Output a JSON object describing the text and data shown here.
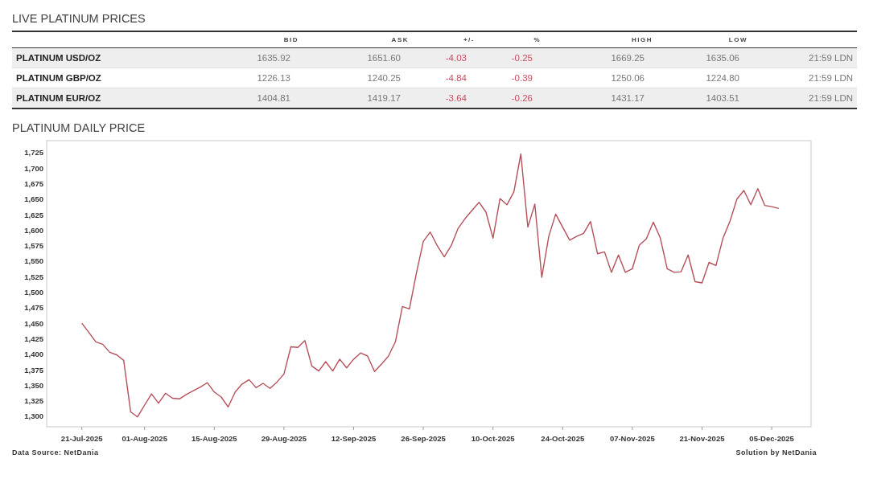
{
  "live_prices": {
    "title": "LIVE PLATINUM PRICES",
    "columns": [
      "",
      "BID",
      "ASK",
      "+/-",
      "%",
      "HIGH",
      "LOW",
      ""
    ],
    "rows": [
      {
        "cells": [
          "PLATINUM USD/OZ",
          "1635.92",
          "1651.60",
          "-4.03",
          "-0.25",
          "1669.25",
          "1635.06",
          "21:59 LDN"
        ]
      },
      {
        "cells": [
          "PLATINUM GBP/OZ",
          "1226.13",
          "1240.25",
          "-4.84",
          "-0.39",
          "1250.06",
          "1224.80",
          "21:59 LDN"
        ]
      },
      {
        "cells": [
          "PLATINUM EUR/OZ",
          "1404.81",
          "1419.17",
          "-3.64",
          "-0.26",
          "1431.17",
          "1403.51",
          "21:59 LDN"
        ]
      }
    ]
  },
  "daily_chart": {
    "title": "PLATINUM DAILY PRICE",
    "chart_data": {
      "type": "line",
      "categories": [
        "21-Jul-2025",
        null,
        null,
        null,
        null,
        null,
        null,
        null,
        null,
        "01-Aug-2025",
        null,
        null,
        null,
        null,
        null,
        null,
        null,
        null,
        null,
        "15-Aug-2025",
        null,
        null,
        null,
        null,
        null,
        null,
        null,
        null,
        null,
        "29-Aug-2025",
        null,
        null,
        null,
        null,
        null,
        null,
        null,
        null,
        null,
        "12-Sep-2025",
        null,
        null,
        null,
        null,
        null,
        null,
        null,
        null,
        null,
        "26-Sep-2025",
        null,
        null,
        null,
        null,
        null,
        null,
        null,
        null,
        null,
        "10-Oct-2025",
        null,
        null,
        null,
        null,
        null,
        null,
        null,
        null,
        null,
        "24-Oct-2025",
        null,
        null,
        null,
        null,
        null,
        null,
        null,
        null,
        null,
        "07-Nov-2025",
        null,
        null,
        null,
        null,
        null,
        null,
        null,
        null,
        null,
        "21-Nov-2025",
        null,
        null,
        null,
        null,
        null,
        null,
        null,
        null,
        null,
        "05-Dec-2025",
        null
      ],
      "series": [
        {
          "color": "#b5505a",
          "values": [
            1450,
            1435,
            1420,
            1416,
            1403,
            1399,
            1390,
            1307,
            1299,
            1318,
            1336,
            1321,
            1337,
            1329,
            1328,
            1335,
            1341,
            1347,
            1354,
            1339,
            1331,
            1315,
            1339,
            1352,
            1359,
            1346,
            1353,
            1345,
            1355,
            1368,
            1412,
            1411,
            1422,
            1381,
            1373,
            1388,
            1373,
            1392,
            1378,
            1392,
            1402,
            1397,
            1372,
            1384,
            1397,
            1420,
            1477,
            1473,
            1530,
            1582,
            1597,
            1575,
            1557,
            1575,
            1603,
            1619,
            1632,
            1645,
            1629,
            1587,
            1651,
            1641,
            1662,
            1723,
            1605,
            1642,
            1524,
            1590,
            1626,
            1605,
            1584,
            1590,
            1595,
            1614,
            1562,
            1565,
            1532,
            1560,
            1532,
            1538,
            1576,
            1586,
            1613,
            1588,
            1538,
            1532,
            1533,
            1560,
            1517,
            1515,
            1548,
            1543,
            1587,
            1614,
            1650,
            1664,
            1641,
            1667,
            1640,
            1638,
            1635
          ]
        }
      ],
      "ylim": [
        1283,
        1744.4
      ],
      "yticks": [
        {
          "value": 1300,
          "label": "1,300"
        },
        {
          "value": 1325,
          "label": "1,325"
        },
        {
          "value": 1350,
          "label": "1,350"
        },
        {
          "value": 1375,
          "label": "1,375"
        },
        {
          "value": 1400,
          "label": "1,400"
        },
        {
          "value": 1425,
          "label": "1,425"
        },
        {
          "value": 1450,
          "label": "1,450"
        },
        {
          "value": 1475,
          "label": "1,475"
        },
        {
          "value": 1500,
          "label": "1,500"
        },
        {
          "value": 1525,
          "label": "1,525"
        },
        {
          "value": 1550,
          "label": "1,550"
        },
        {
          "value": 1575,
          "label": "1,575"
        },
        {
          "value": 1600,
          "label": "1,600"
        },
        {
          "value": 1625,
          "label": "1,625"
        },
        {
          "value": 1650,
          "label": "1,650"
        },
        {
          "value": 1675,
          "label": "1,675"
        },
        {
          "value": 1700,
          "label": "1,700"
        },
        {
          "value": 1725,
          "label": "1,725"
        }
      ]
    },
    "source": "Data Source: NetDania",
    "credit": "Solution by NetDania"
  }
}
